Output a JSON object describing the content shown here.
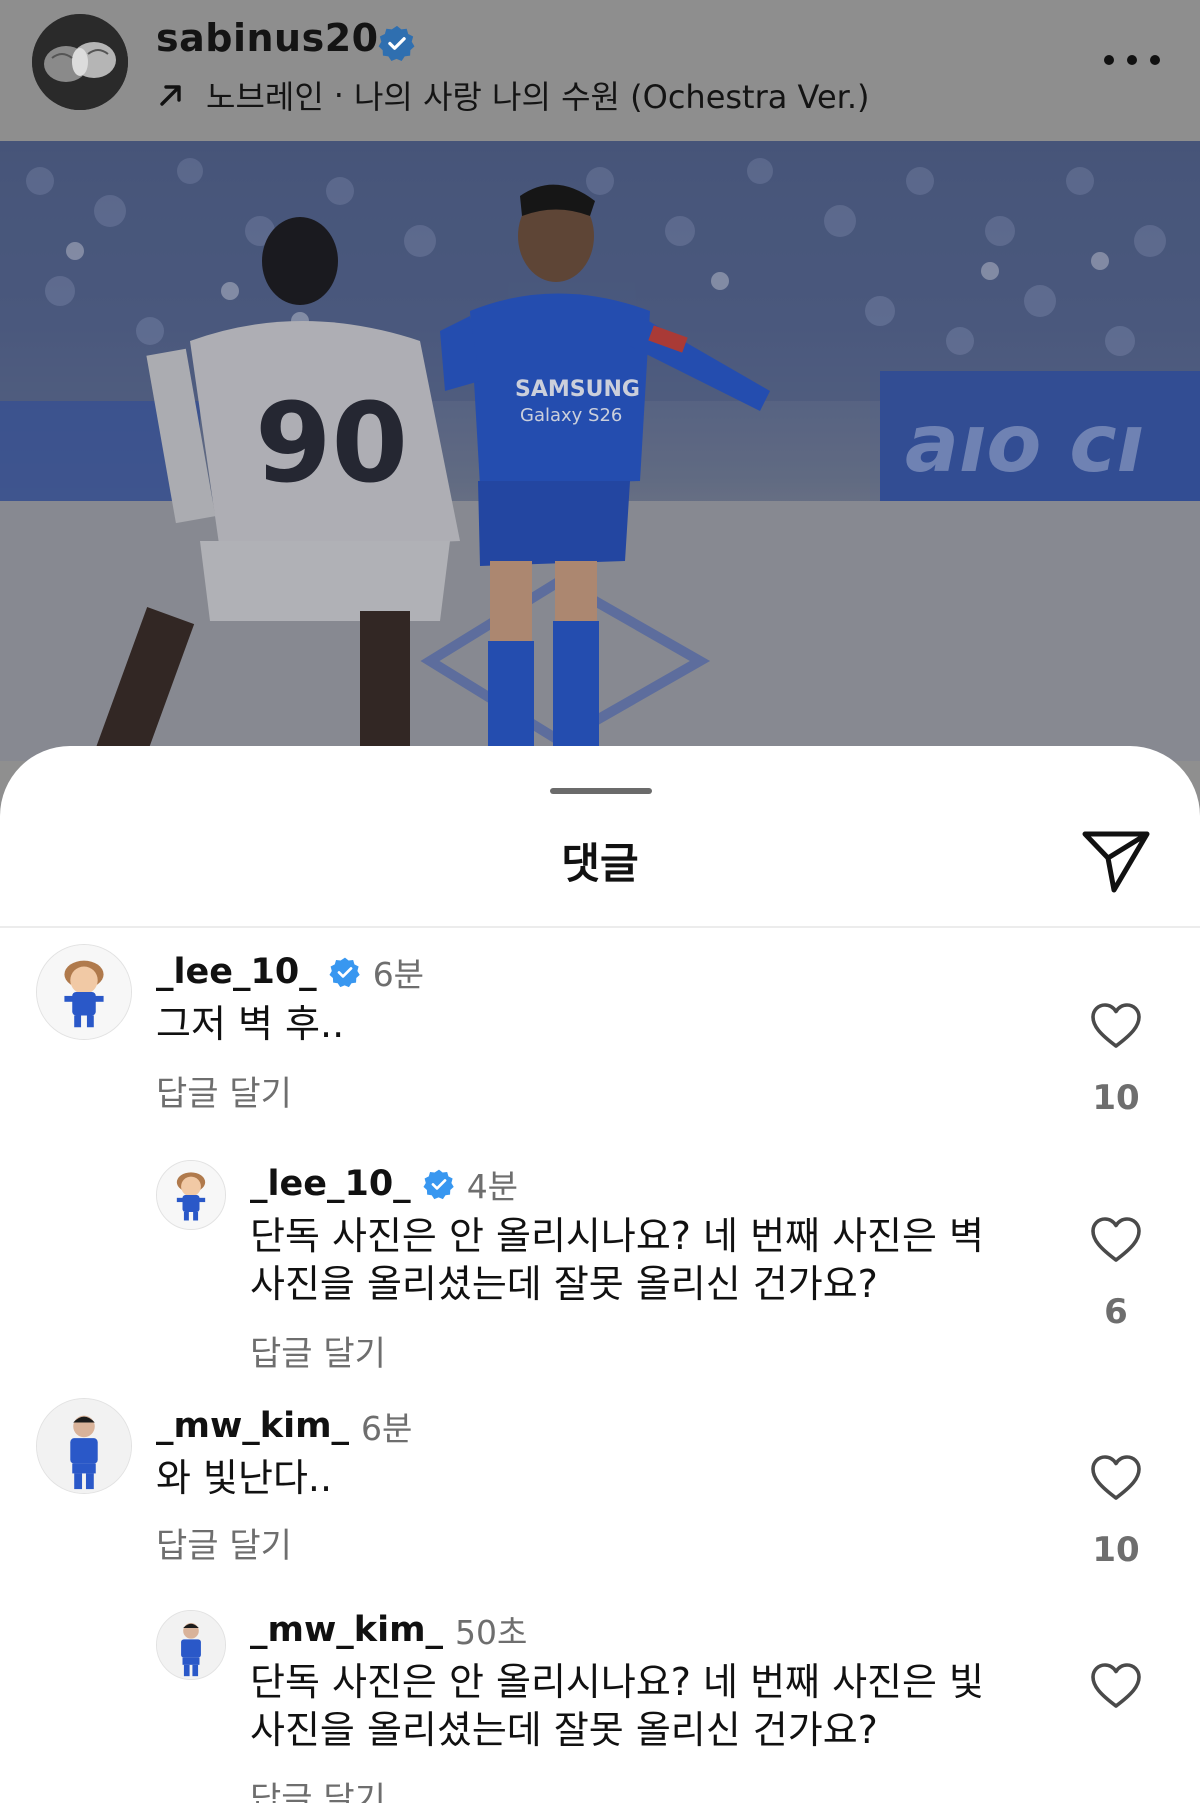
{
  "post": {
    "username": "sabinus20",
    "music_artist": "노브레인",
    "music_separator": "·",
    "music_title": "나의 사랑 나의 수원 (Ochestra Ver.)",
    "more_icon": "more-dots-icon"
  },
  "sheet": {
    "title": "댓글",
    "share_icon": "paper-plane-icon"
  },
  "comments": [
    {
      "username": "_lee_10_",
      "verified": true,
      "time": "6분",
      "text": "그저 벽 후..",
      "reply_label": "답글 달기",
      "likes": "10"
    },
    {
      "username": "_lee_10_",
      "verified": true,
      "time": "4분",
      "text": "단독 사진은 안 올리시나요? 네 번째 사진은 벽\n사진을 올리셨는데 잘못 올리신 건가요?",
      "reply_label": "답글 달기",
      "likes": "6"
    },
    {
      "username": "_mw_kim_",
      "verified": false,
      "time": "6분",
      "text": "와 빛난다..",
      "reply_label": "답글 달기",
      "likes": "10"
    },
    {
      "username": "_mw_kim_",
      "verified": false,
      "time": "50초",
      "text": "단독 사진은 안 올리시나요? 네 번째 사진은 빛\n사진을 올리셨는데 잘못 올리신 건가요?",
      "reply_label": "답글 달기",
      "likes": ""
    }
  ],
  "colors": {
    "verified_blue": "#3897f0",
    "secondary_text": "#6e6e6e",
    "kit_blue": "#2a58c8"
  }
}
